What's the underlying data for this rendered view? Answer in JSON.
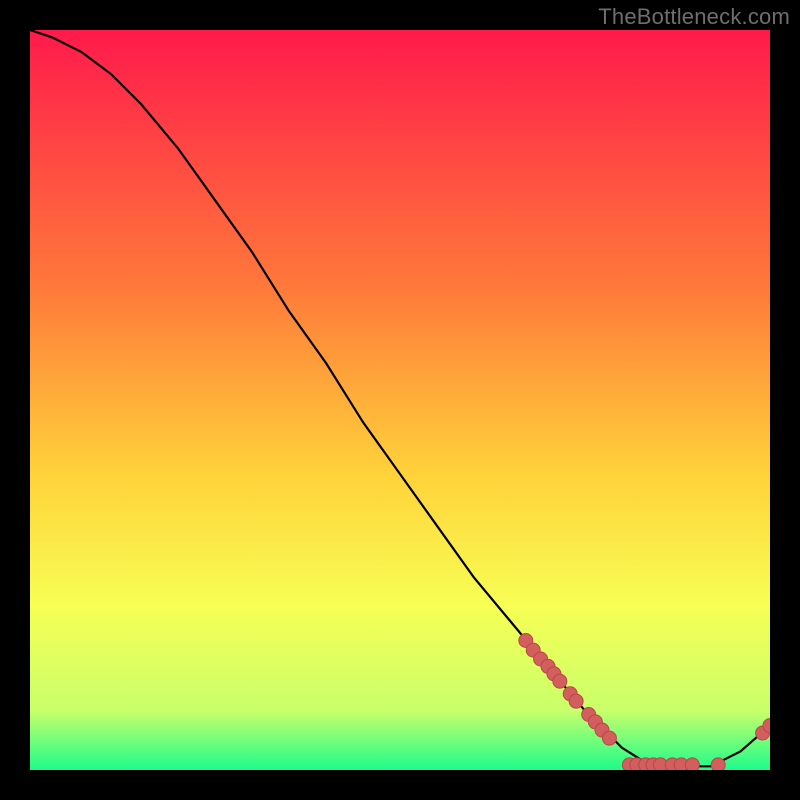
{
  "attribution": "TheBottleneck.com",
  "colors": {
    "gradient_top": "#ff1a4b",
    "gradient_mid1": "#ff7a3a",
    "gradient_mid2": "#ffd23a",
    "gradient_mid3": "#f7ff55",
    "gradient_mid4": "#c8ff6a",
    "gradient_bottom": "#1dfc8a",
    "curve": "#000000",
    "marker_fill": "#d35e5e",
    "marker_stroke": "#b94747",
    "marker_r": 7
  },
  "chart_data": {
    "type": "line",
    "title": "",
    "xlabel": "",
    "ylabel": "",
    "xlim": [
      0,
      100
    ],
    "ylim": [
      0,
      100
    ],
    "curve": [
      {
        "x": 0,
        "y": 100
      },
      {
        "x": 3,
        "y": 99
      },
      {
        "x": 7,
        "y": 97
      },
      {
        "x": 11,
        "y": 94
      },
      {
        "x": 15,
        "y": 90
      },
      {
        "x": 20,
        "y": 84
      },
      {
        "x": 25,
        "y": 77
      },
      {
        "x": 30,
        "y": 70
      },
      {
        "x": 35,
        "y": 62
      },
      {
        "x": 40,
        "y": 55
      },
      {
        "x": 45,
        "y": 47
      },
      {
        "x": 50,
        "y": 40
      },
      {
        "x": 55,
        "y": 33
      },
      {
        "x": 60,
        "y": 26
      },
      {
        "x": 65,
        "y": 20
      },
      {
        "x": 70,
        "y": 14
      },
      {
        "x": 75,
        "y": 8
      },
      {
        "x": 80,
        "y": 3
      },
      {
        "x": 84,
        "y": 0.5
      },
      {
        "x": 88,
        "y": 0.5
      },
      {
        "x": 92,
        "y": 0.5
      },
      {
        "x": 96,
        "y": 2.5
      },
      {
        "x": 100,
        "y": 6
      }
    ],
    "markers": [
      {
        "x": 67,
        "y": 17.5
      },
      {
        "x": 68,
        "y": 16.2
      },
      {
        "x": 69,
        "y": 15.0
      },
      {
        "x": 70,
        "y": 14.0
      },
      {
        "x": 70.8,
        "y": 13.0
      },
      {
        "x": 71.6,
        "y": 12.0
      },
      {
        "x": 73.0,
        "y": 10.3
      },
      {
        "x": 73.8,
        "y": 9.3
      },
      {
        "x": 75.5,
        "y": 7.5
      },
      {
        "x": 76.4,
        "y": 6.5
      },
      {
        "x": 77.3,
        "y": 5.4
      },
      {
        "x": 78.3,
        "y": 4.3
      },
      {
        "x": 81.0,
        "y": 0.7
      },
      {
        "x": 82.0,
        "y": 0.7
      },
      {
        "x": 83.2,
        "y": 0.7
      },
      {
        "x": 84.2,
        "y": 0.7
      },
      {
        "x": 85.2,
        "y": 0.7
      },
      {
        "x": 86.8,
        "y": 0.7
      },
      {
        "x": 88.0,
        "y": 0.7
      },
      {
        "x": 89.5,
        "y": 0.7
      },
      {
        "x": 93.0,
        "y": 0.7
      },
      {
        "x": 99.0,
        "y": 5.0
      },
      {
        "x": 100.0,
        "y": 6.0
      }
    ]
  }
}
